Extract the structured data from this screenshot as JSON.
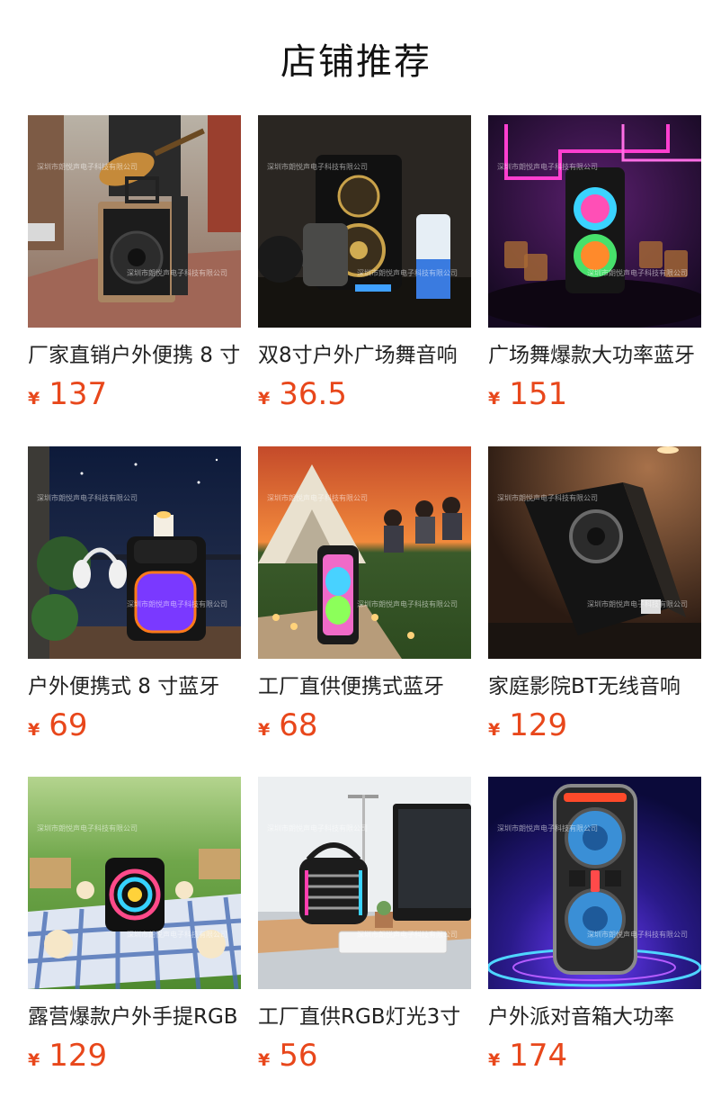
{
  "section": {
    "title": "店铺推荐"
  },
  "currency_symbol": "¥",
  "watermark": "深圳市朗悦声电子科技有限公司",
  "products": [
    {
      "name": "厂家直销户外便携 8 寸",
      "price": "137",
      "image_icon": "street-busker-speaker-image"
    },
    {
      "name": "双8寸户外广场舞音响",
      "price": "36.5",
      "image_icon": "gym-speaker-image"
    },
    {
      "name": "广场舞爆款大功率蓝牙",
      "price": "151",
      "image_icon": "neon-party-speaker-image"
    },
    {
      "name": "户外便携式 8 寸蓝牙",
      "price": "69",
      "image_icon": "balcony-night-speaker-image"
    },
    {
      "name": "工厂直供便携式蓝牙",
      "price": "68",
      "image_icon": "camping-sunset-speaker-image"
    },
    {
      "name": "家庭影院BT无线音响",
      "price": "129",
      "image_icon": "home-theater-speaker-image"
    },
    {
      "name": "露营爆款户外手提RGB",
      "price": "129",
      "image_icon": "picnic-rgb-speaker-image"
    },
    {
      "name": "工厂直供RGB灯光3寸",
      "price": "56",
      "image_icon": "desk-retro-speaker-image"
    },
    {
      "name": "户外派对音箱大功率",
      "price": "174",
      "image_icon": "party-tower-speaker-image"
    }
  ]
}
